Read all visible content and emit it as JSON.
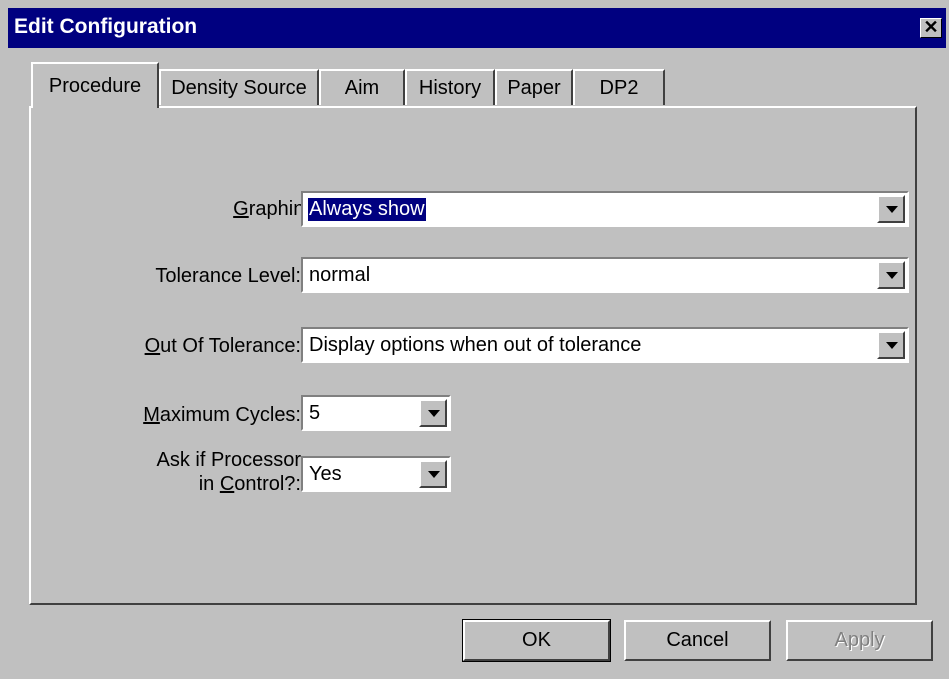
{
  "window": {
    "title": "Edit Configuration",
    "close_glyph": "✕"
  },
  "tabs": [
    {
      "label": "Procedure",
      "active": true
    },
    {
      "label": "Density Source"
    },
    {
      "label": "Aim"
    },
    {
      "label": "History"
    },
    {
      "label": "Paper"
    },
    {
      "label": "DP2"
    }
  ],
  "fields": {
    "graphing": {
      "label_mnemonic": "G",
      "label_rest": "raphing:",
      "value": "Always show"
    },
    "tolerance_level": {
      "label": "Tolerance Level:",
      "value": "normal"
    },
    "out_of_tolerance": {
      "label_mnemonic": "O",
      "label_rest": "ut Of Tolerance:",
      "value": "Display options when out of tolerance"
    },
    "maximum_cycles": {
      "label_mnemonic": "M",
      "label_rest": "aximum Cycles:",
      "value": "5"
    },
    "ask_processor": {
      "label_line1": "Ask if Processor",
      "label_line2_prefix": "in ",
      "label_mnemonic": "C",
      "label_rest": "ontrol?:",
      "value": "Yes"
    }
  },
  "buttons": {
    "ok": "OK",
    "cancel": "Cancel",
    "apply": "Apply"
  }
}
